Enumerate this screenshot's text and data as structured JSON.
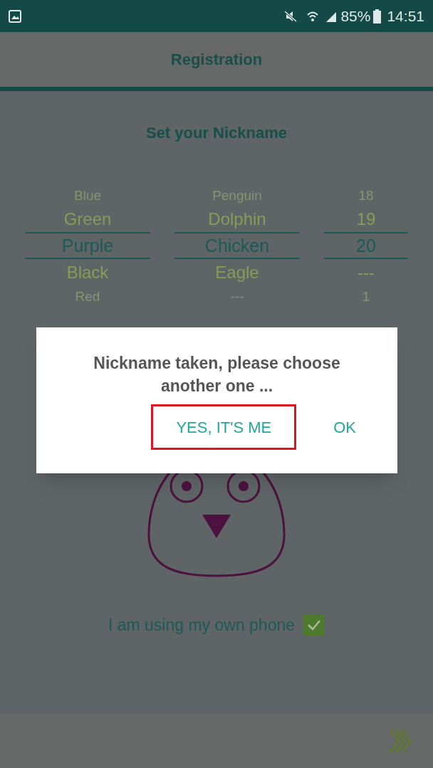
{
  "status_bar": {
    "battery": "85%",
    "time": "14:51"
  },
  "header": {
    "title": "Registration"
  },
  "heading": "Set your Nickname",
  "pickers": [
    {
      "items": [
        {
          "label": "Blue",
          "selected": false
        },
        {
          "label": "Green",
          "selected": false
        },
        {
          "label": "Purple",
          "selected": true
        },
        {
          "label": "Black",
          "selected": false
        },
        {
          "label": "Red",
          "selected": false
        }
      ]
    },
    {
      "items": [
        {
          "label": "Penguin",
          "selected": false
        },
        {
          "label": "Dolphin",
          "selected": false
        },
        {
          "label": "Chicken",
          "selected": true
        },
        {
          "label": "Eagle",
          "selected": false
        },
        {
          "label": "---",
          "selected": false
        }
      ]
    },
    {
      "items": [
        {
          "label": "18",
          "selected": false
        },
        {
          "label": "19",
          "selected": false
        },
        {
          "label": "20",
          "selected": true
        },
        {
          "label": "---",
          "selected": false
        },
        {
          "label": "1",
          "selected": false
        }
      ]
    }
  ],
  "own_phone": {
    "label": "I am using my own phone",
    "checked": true
  },
  "dialog": {
    "message": "Nickname taken, please choose another one ...",
    "buttons": [
      {
        "label": "YES, IT'S ME",
        "highlighted": true
      },
      {
        "label": "OK",
        "highlighted": false
      }
    ]
  }
}
